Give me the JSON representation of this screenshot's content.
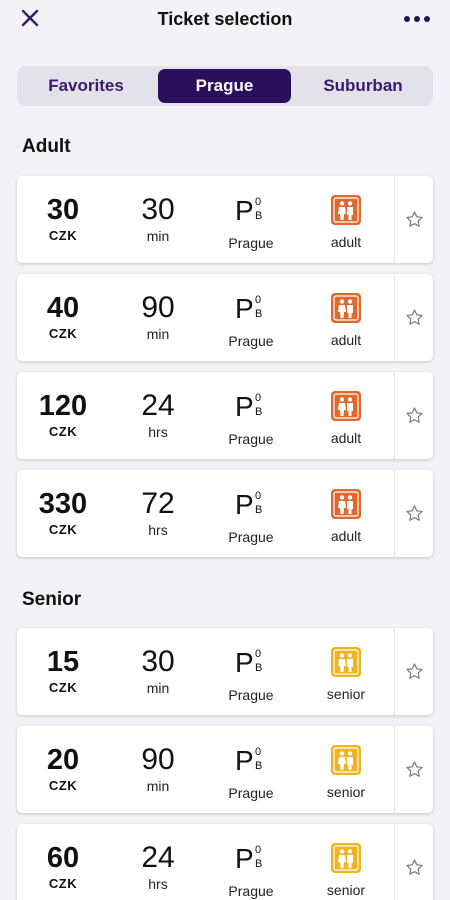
{
  "header": {
    "title": "Ticket selection",
    "close_icon": "close-icon",
    "more_icon": "more-dots-icon"
  },
  "tabs": [
    {
      "label": "Favorites",
      "active": false
    },
    {
      "label": "Prague",
      "active": true
    },
    {
      "label": "Suburban",
      "active": false
    }
  ],
  "colors": {
    "accent": "#2b0f5c",
    "adult_icon": "#e06a2c",
    "senior_icon": "#efb521"
  },
  "sections": [
    {
      "title": "Adult",
      "tickets": [
        {
          "price": "30",
          "currency": "CZK",
          "duration": "30",
          "unit": "min",
          "zone": "P",
          "zone_sup": "0",
          "zone_sub": "B",
          "zone_name": "Prague",
          "passenger": "adult"
        },
        {
          "price": "40",
          "currency": "CZK",
          "duration": "90",
          "unit": "min",
          "zone": "P",
          "zone_sup": "0",
          "zone_sub": "B",
          "zone_name": "Prague",
          "passenger": "adult"
        },
        {
          "price": "120",
          "currency": "CZK",
          "duration": "24",
          "unit": "hrs",
          "zone": "P",
          "zone_sup": "0",
          "zone_sub": "B",
          "zone_name": "Prague",
          "passenger": "adult"
        },
        {
          "price": "330",
          "currency": "CZK",
          "duration": "72",
          "unit": "hrs",
          "zone": "P",
          "zone_sup": "0",
          "zone_sub": "B",
          "zone_name": "Prague",
          "passenger": "adult"
        }
      ]
    },
    {
      "title": "Senior",
      "tickets": [
        {
          "price": "15",
          "currency": "CZK",
          "duration": "30",
          "unit": "min",
          "zone": "P",
          "zone_sup": "0",
          "zone_sub": "B",
          "zone_name": "Prague",
          "passenger": "senior"
        },
        {
          "price": "20",
          "currency": "CZK",
          "duration": "90",
          "unit": "min",
          "zone": "P",
          "zone_sup": "0",
          "zone_sub": "B",
          "zone_name": "Prague",
          "passenger": "senior"
        },
        {
          "price": "60",
          "currency": "CZK",
          "duration": "24",
          "unit": "hrs",
          "zone": "P",
          "zone_sup": "0",
          "zone_sub": "B",
          "zone_name": "Prague",
          "passenger": "senior"
        }
      ]
    }
  ]
}
